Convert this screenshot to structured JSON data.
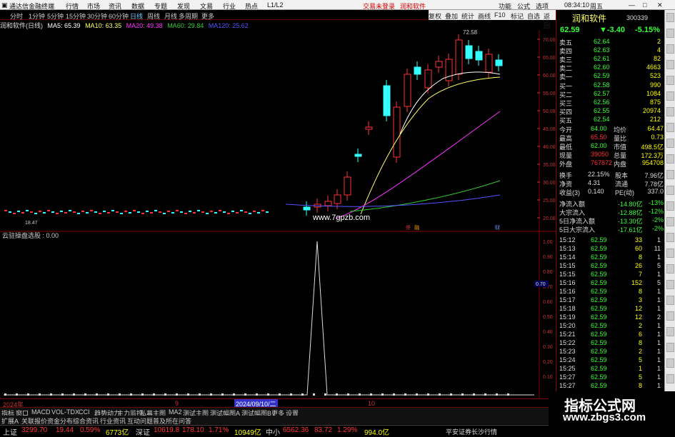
{
  "app": {
    "title": "通达信金融终端",
    "menu": [
      "行情",
      "市场",
      "资讯",
      "数据",
      "专题",
      "发现",
      "文易",
      "行业",
      "热点",
      "L1/L2"
    ],
    "trade_login": "交易未登录",
    "stock_tab": "润和软件",
    "right_menu": [
      "功能",
      "公式",
      "选项"
    ],
    "time": "08:34:10",
    "weekday": "周五"
  },
  "toolbar": {
    "periods": [
      "分时",
      "1分钟",
      "5分钟",
      "15分钟",
      "30分钟",
      "60分钟",
      "日线",
      "周线",
      "月线",
      "多周期",
      "更多"
    ],
    "right": [
      "复权",
      "叠加",
      "统计",
      "画线",
      "F10",
      "标记",
      "自选",
      "返回"
    ]
  },
  "ma_line": {
    "name": "润和软件(日线)",
    "ma5": "MA5: 65.39",
    "ma10": "MA10: 63.35",
    "ma20": "MA20: 49.38",
    "ma60": "MA60: 29.84",
    "ma120": "MA120: 25.62"
  },
  "chart": {
    "watermark": "www.7gpzb.com",
    "peak_label": "72.58",
    "low_label": "18.47",
    "marks": [
      "杀",
      "融",
      "财"
    ],
    "price_axis": [
      "70.00",
      "65.00",
      "60.00",
      "55.00",
      "50.00",
      "45.00",
      "40.00",
      "35.00",
      "30.00",
      "25.00",
      "20.00"
    ]
  },
  "indicator": {
    "title": "云驻操盘选股 : 0.00",
    "axis": [
      "1.00",
      "0.90",
      "0.80",
      "0.70",
      "0.60",
      "0.50",
      "0.40",
      "0.30",
      "0.20",
      "0.10"
    ],
    "marker": "0.70"
  },
  "datebar": {
    "year": "2024年",
    "m9": "9",
    "sel": "2024/09/10/二",
    "m10": "10"
  },
  "tabs": [
    "指标",
    "窗口",
    "MACD",
    "VOL-TDX",
    "CCI",
    "趋势动力",
    "主力监控",
    "私募主图",
    "MA2",
    "测试主图",
    "测试幅图A",
    "测试幅图B",
    "更多",
    "设置"
  ],
  "tabs2": [
    "扩展A",
    "关联报价",
    "资金分布",
    "综合资讯",
    "行业资讯",
    "互动问题",
    "普及所在问答"
  ],
  "status": {
    "sh_label": "上证",
    "sh_val": "3299.70",
    "sh_chg": "19.44",
    "sh_pct": "0.59%",
    "sh_amt": "6773亿",
    "sz_label": "深证",
    "sz_val": "10619.8",
    "sz_chg": "178.10",
    "sz_pct": "1.71%",
    "sz_amt": "10949亿",
    "zx_label": "中小",
    "zx_val": "6562.36",
    "zx_chg": "83.72",
    "zx_pct": "1.29%",
    "zx_amt": "994.0亿",
    "broker": "平安证券长沙行情"
  },
  "quote": {
    "name": "润和软件",
    "code": "300339",
    "price": "62.59",
    "chg": "▼-3.40",
    "pct": "-5.15%",
    "asks": [
      {
        "l": "卖五",
        "p": "62.64",
        "v": "2"
      },
      {
        "l": "卖四",
        "p": "62.63",
        "v": "4"
      },
      {
        "l": "卖三",
        "p": "62.61",
        "v": "82"
      },
      {
        "l": "卖二",
        "p": "62.60",
        "v": "4663"
      },
      {
        "l": "卖一",
        "p": "62.59",
        "v": "523"
      }
    ],
    "bids": [
      {
        "l": "买一",
        "p": "62.58",
        "v": "990"
      },
      {
        "l": "买二",
        "p": "62.57",
        "v": "1084"
      },
      {
        "l": "买三",
        "p": "62.56",
        "v": "875"
      },
      {
        "l": "买四",
        "p": "62.55",
        "v": "20974"
      },
      {
        "l": "买五",
        "p": "62.54",
        "v": "212"
      }
    ],
    "stats": [
      [
        "今开",
        "64.00",
        "均价",
        "64.47"
      ],
      [
        "最高",
        "65.50",
        "量比",
        "0.73"
      ],
      [
        "最低",
        "62.00",
        "市值",
        "498.5亿"
      ],
      [
        "现量",
        "39050",
        "总量",
        "172.3万"
      ],
      [
        "外盘",
        "767872",
        "内盘",
        "954708"
      ]
    ],
    "stats2": [
      [
        "换手",
        "22.15%",
        "股本",
        "7.96亿"
      ],
      [
        "净资",
        "4.31",
        "流通",
        "7.78亿"
      ],
      [
        "收益(3)",
        "0.140",
        "PE(动)",
        "337.0"
      ]
    ],
    "flows": [
      [
        "净流入额",
        "-14.80亿",
        "-13%"
      ],
      [
        "大宗流入",
        "-12.88亿",
        "-12%"
      ],
      [
        "5日净流入额",
        "-13.30亿",
        "-2%"
      ],
      [
        "5日大宗流入",
        "-17.61亿",
        "-2%"
      ]
    ],
    "ticks": [
      [
        "15:12",
        "62.59",
        "33",
        "1"
      ],
      [
        "15:13",
        "62.59",
        "60",
        "11"
      ],
      [
        "15:14",
        "62.59",
        "8",
        "1"
      ],
      [
        "15:15",
        "62.59",
        "26",
        "5"
      ],
      [
        "15:15",
        "62.59",
        "7",
        "1"
      ],
      [
        "15:16",
        "62.59",
        "152",
        "5"
      ],
      [
        "15:16",
        "62.59",
        "8",
        "1"
      ],
      [
        "15:17",
        "62.59",
        "3",
        "1"
      ],
      [
        "15:18",
        "62.59",
        "12",
        "1"
      ],
      [
        "15:19",
        "62.59",
        "12",
        "2"
      ],
      [
        "15:20",
        "62.59",
        "2",
        "1"
      ],
      [
        "15:21",
        "62.59",
        "6",
        "1"
      ],
      [
        "15:22",
        "62.59",
        "8",
        "1"
      ],
      [
        "15:23",
        "62.59",
        "2",
        "1"
      ],
      [
        "15:24",
        "62.59",
        "5",
        "1"
      ],
      [
        "15:25",
        "62.59",
        "1",
        "1"
      ],
      [
        "15:27",
        "62.59",
        "5",
        "1"
      ],
      [
        "15:27",
        "62.59",
        "8",
        "1"
      ]
    ]
  },
  "footer_watermark": {
    "line1": "指标公式网",
    "line2": "www.zbgs3.com"
  },
  "colors": {
    "bg": "#000000",
    "up": "#ff3333",
    "down": "#33ff33",
    "ma5": "#ffffff",
    "ma10": "#ffff66",
    "ma20": "#ff33ff",
    "ma60": "#33cc33",
    "ma120": "#5555ff"
  }
}
